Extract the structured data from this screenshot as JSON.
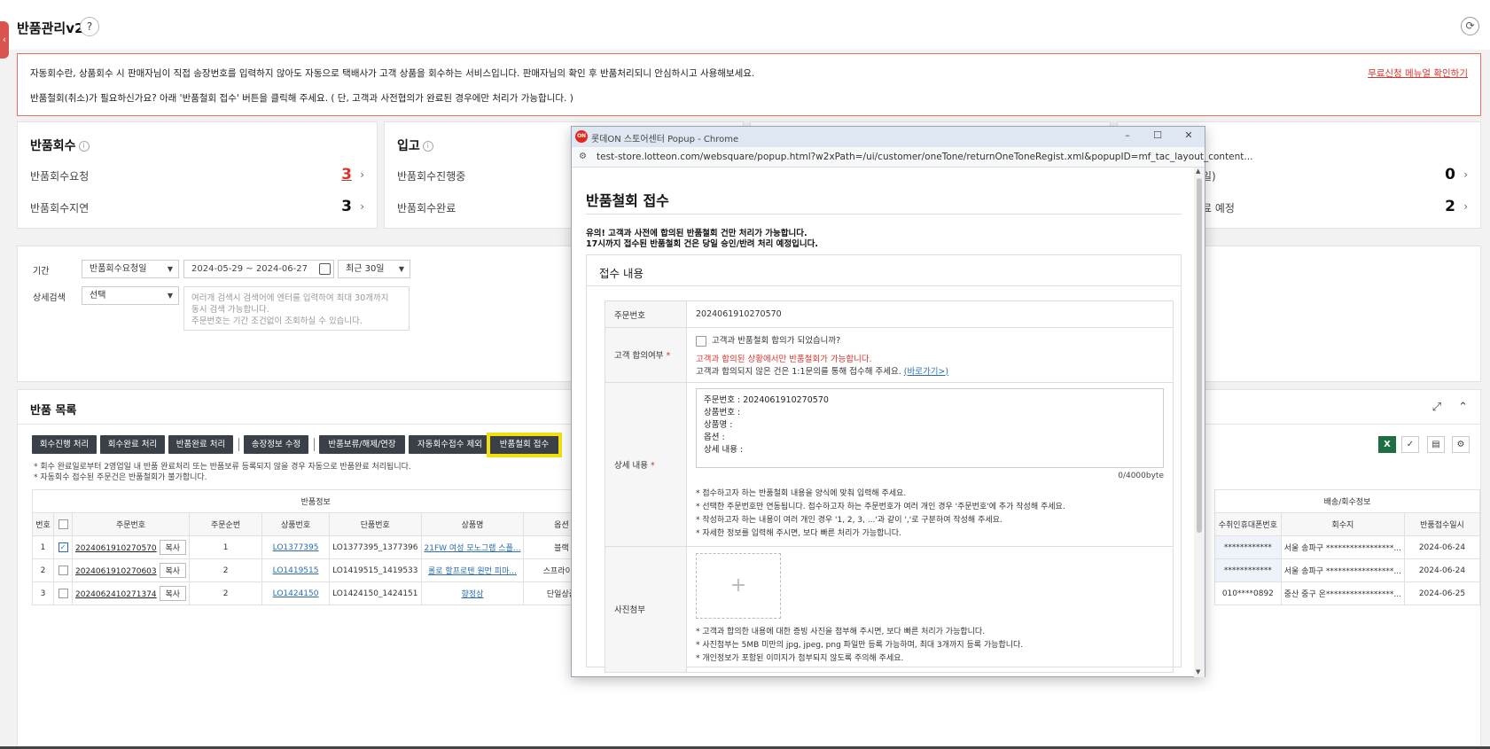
{
  "page": {
    "title": "반품관리v2",
    "help": "?",
    "side_tab": "‹",
    "refresh": "⟳"
  },
  "notice": {
    "line1": "자동회수란, 상품회수 시 판매자님이 직접 송장번호를 입력하지 않아도 자동으로 택배사가 고객 상품을 회수하는 서비스입니다. 판매자님의 확인 후 반품처리되니 안심하시고 사용해보세요.",
    "line2": "반품철회(취소)가 필요하신가요? 아래 '반품철회 접수' 버튼을 클릭해 주세요. ( 단, 고객과 사전협의가 완료된 경우에만 처리가 가능합니다. )",
    "link": "무료신청 메뉴얼 확인하기"
  },
  "cards": [
    {
      "title": "반품회수",
      "rows": [
        {
          "label": "반품회수요청",
          "value": "3",
          "highlight": true
        },
        {
          "label": "반품회수지연",
          "value": "3",
          "highlight": false
        }
      ]
    },
    {
      "title": "입고",
      "rows": [
        {
          "label": "반품회수진행중",
          "value": "",
          "highlight": false
        },
        {
          "label": "반품회수완료",
          "value": "",
          "highlight": false
        }
      ]
    },
    {
      "title": "",
      "rows": [
        {
          "label": "일)",
          "value": "0",
          "highlight": false
        },
        {
          "label": "료 예정",
          "value": "2",
          "highlight": false
        }
      ]
    }
  ],
  "filter": {
    "period_label": "기간",
    "period_type": "반품회수요청일",
    "date_range": "2024-05-29 ~ 2024-06-27",
    "period_preset": "최근 30일",
    "detail_label": "상세검색",
    "detail_select": "선택",
    "detail_placeholder_1": "여러개 검색시 검색어에 엔터를 입력하여 최대 30개까지",
    "detail_placeholder_2": "동시 검색 가능합니다.",
    "detail_placeholder_3": "주문번호는 기간 조건없이 조회하실 수 있습니다."
  },
  "list": {
    "title": "반품 목록",
    "buttons": [
      "회수진행 처리",
      "회수완료 처리",
      "반품완료 처리",
      "송장정보 수정",
      "반품보류/해제/연장",
      "자동회수접수 제외"
    ],
    "highlight_button": "반품철회 접수",
    "note1": "* 회수 완료일로부터 2영업일 내 반품 완료처리 또는 반품보류 등록되지 않을 경우 자동으로 반품완료 처리됩니다.",
    "note2": "* 자동회수 접수된 주문건은 반품철회가 불가합니다.",
    "group_header": "반품정보",
    "group_header2": "배송/회수정보",
    "columns": [
      "번호",
      "",
      "주문번호",
      "주문순번",
      "상품번호",
      "단품번호",
      "상품명",
      "옵션"
    ],
    "columns2": [
      "수취인휴대폰번호",
      "회수지",
      "반품접수일시"
    ],
    "rows": [
      {
        "no": "1",
        "checked": true,
        "order_no": "2024061910270570",
        "copy": "복사",
        "seq": "1",
        "product_no": "LO1377395",
        "item_no": "LO1377395_1377396",
        "name": "21FW 여성 모노그램 스플...",
        "option": "블랙",
        "phone": "************",
        "address": "서울 송파구 *****************...",
        "date": "2024-06-24"
      },
      {
        "no": "2",
        "checked": false,
        "order_no": "2024061910270603",
        "copy": "복사",
        "seq": "2",
        "product_no": "LO1419515",
        "item_no": "LO1419515_1419533",
        "name": "롤로 할프로텐 원먼 피마...",
        "option": "스프라이트",
        "phone": "************",
        "address": "서울 송파구 *****************...",
        "date": "2024-06-24"
      },
      {
        "no": "3",
        "checked": false,
        "order_no": "2024062410271374",
        "copy": "복사",
        "seq": "2",
        "product_no": "LO1424150",
        "item_no": "LO1424150_1424151",
        "name": "향정삼",
        "option": "단일상품",
        "phone": "010****0892",
        "address": "중산 중구 온*****************...",
        "date": "2024-06-25"
      }
    ]
  },
  "popup": {
    "window_title": "롯데ON 스토어센터 Popup - Chrome",
    "logo": "ON",
    "url": "test-store.lotteon.com/websquare/popup.html?w2xPath=/ui/customer/oneTone/returnOneToneRegist.xml&popupID=mf_tac_layout_content...",
    "heading": "반품철회 접수",
    "warn1": "유의! 고객과 사전에 합의된 반품철회 건만 처리가 가능합니다.",
    "warn2": "17시까지 접수된 반품철회 건은 당일 승인/반려 처리 예정입니다.",
    "section_title": "접수 내용",
    "order_label": "주문번호",
    "order_value": "2024061910270570",
    "agree_label": "고객 합의여부",
    "agree_check": "고객과 반품철회 합의가 되었습니까?",
    "agree_red": "고객과 합의된 상황에서만 반품철회가 가능합니다.",
    "agree_note": "고객과 합의되지 않은 건은 1:1문의를 통해 접수해 주세요.",
    "agree_link": "(바로가기>)",
    "detail_label": "상세 내용",
    "detail_lines": [
      "주문번호 : 2024061910270570",
      "상품번호 :",
      "상품명 :",
      "옵션 :",
      "상세 내용 :"
    ],
    "byte_count": "0/4000byte",
    "detail_bullets": [
      "* 접수하고자 하는 반품철회 내용을 양식에 맞춰 입력해 주세요.",
      "* 선택한 주문번호만 연동됩니다. 접수하고자 하는 주문번호가 여러 개인 경우 '주문번호'에 추가 작성해 주세요.",
      "* 작성하고자 하는 내용이 여러 개인 경우 '1, 2, 3, ...'과 같이 ','로 구분하여 작성해 주세요.",
      "* 자세한 정보를 입력해 주시면, 보다 빠른 처리가 가능합니다."
    ],
    "photo_label": "사진첨부",
    "photo_plus": "+",
    "photo_bullets": [
      "* 고객과 합의한 내용에 대한 증빙 사진을 첨부해 주시면, 보다 빠른 처리가 가능합니다.",
      "* 사진첨부는 5MB 미만의 jpg, jpeg, png 파일만 등록 가능하며, 최대 3개까지 등록 가능합니다.",
      "* 개인정보가 포함된 이미지가 첨부되지 않도록 주의해 주세요."
    ]
  },
  "colors": {
    "accent_red": "#d9342b",
    "dark_button": "#3a3f48",
    "highlight": "#f0e10a",
    "link_blue": "#2a6db4"
  }
}
